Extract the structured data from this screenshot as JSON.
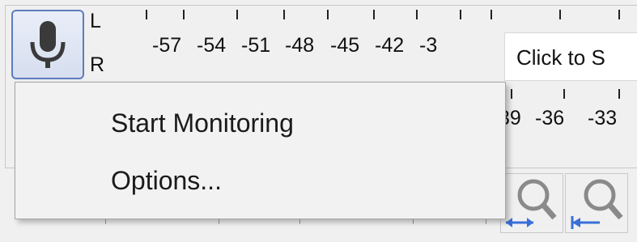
{
  "meter": {
    "left_label": "L",
    "right_label": "R",
    "top_scale": [
      "-57",
      "-54",
      "-51",
      "-48",
      "-45",
      "-42",
      "-3"
    ],
    "bottom_scale": [
      "39",
      "-36",
      "-33"
    ],
    "click_hint": "Click to S"
  },
  "menu": {
    "items": [
      {
        "label": "Start Monitoring"
      },
      {
        "label": "Options..."
      }
    ]
  },
  "colors": {
    "button_border": "#5d7cc0",
    "menu_bg": "#f2f2f2",
    "toolbar_bg": "#f0f0f0",
    "zoom_icon": "#8a8a8a",
    "arrow_blue": "#3a6fd8"
  },
  "icons": {
    "record_meter": "microphone-icon",
    "zoom_fit": "zoom-fit-icon",
    "zoom_width": "zoom-width-icon"
  }
}
